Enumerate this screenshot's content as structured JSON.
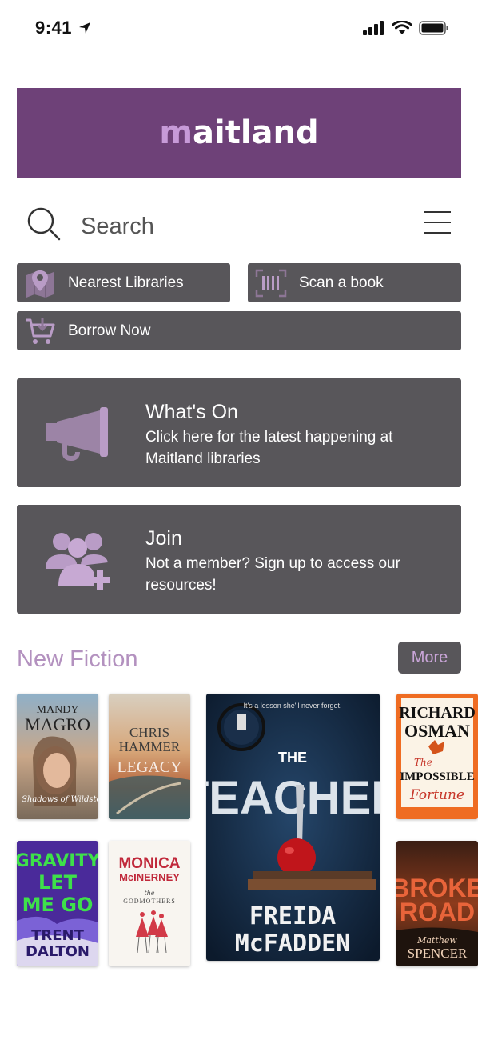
{
  "status": {
    "time": "9:41"
  },
  "brand": {
    "prefix": "m",
    "rest": "aitland"
  },
  "search": {
    "placeholder": "Search"
  },
  "quick_actions": {
    "nearest": "Nearest Libraries",
    "scan": "Scan a book",
    "borrow": "Borrow Now"
  },
  "cards": {
    "whats_on": {
      "title": "What's On",
      "desc": "Click here for the latest happening at Maitland libraries"
    },
    "join": {
      "title": "Join",
      "desc": "Not a member? Sign up to access our resources!"
    }
  },
  "new_fiction": {
    "title": "New Fiction",
    "more": "More",
    "books": [
      {
        "author_line1": "MANDY",
        "author_line2": "MAGRO",
        "title": "Shadows of Wildstone"
      },
      {
        "author_line1": "CHRIS",
        "author_line2": "HAMMER",
        "title": "LEGACY"
      },
      {
        "tagline": "It's a lesson she'll never forget.",
        "title_small": "THE",
        "title_big": "TEACHER",
        "author_line1": "FREIDA",
        "author_line2": "McFADDEN"
      },
      {
        "author_line1": "RICHARD",
        "author_line2": "OSMAN",
        "title_small": "The",
        "title_big": "IMPOSSIBLE",
        "title_end": "Fortune"
      },
      {
        "title_line1": "GRAVITY",
        "title_line2": "LET",
        "title_line3": "ME GO",
        "author_line1": "TRENT",
        "author_line2": "DALTON"
      },
      {
        "author_line1": "MONICA",
        "author_line2": "McINERNEY",
        "title_small": "the",
        "title": "GODMOTHERS"
      },
      {
        "title_line1": "BROKE",
        "title_line2": "ROAD",
        "author_line1": "Matthew",
        "author_line2": "SPENCER"
      }
    ]
  },
  "colors": {
    "brand": "#6e4178",
    "button": "#58565a",
    "accent": "#b391bf"
  }
}
